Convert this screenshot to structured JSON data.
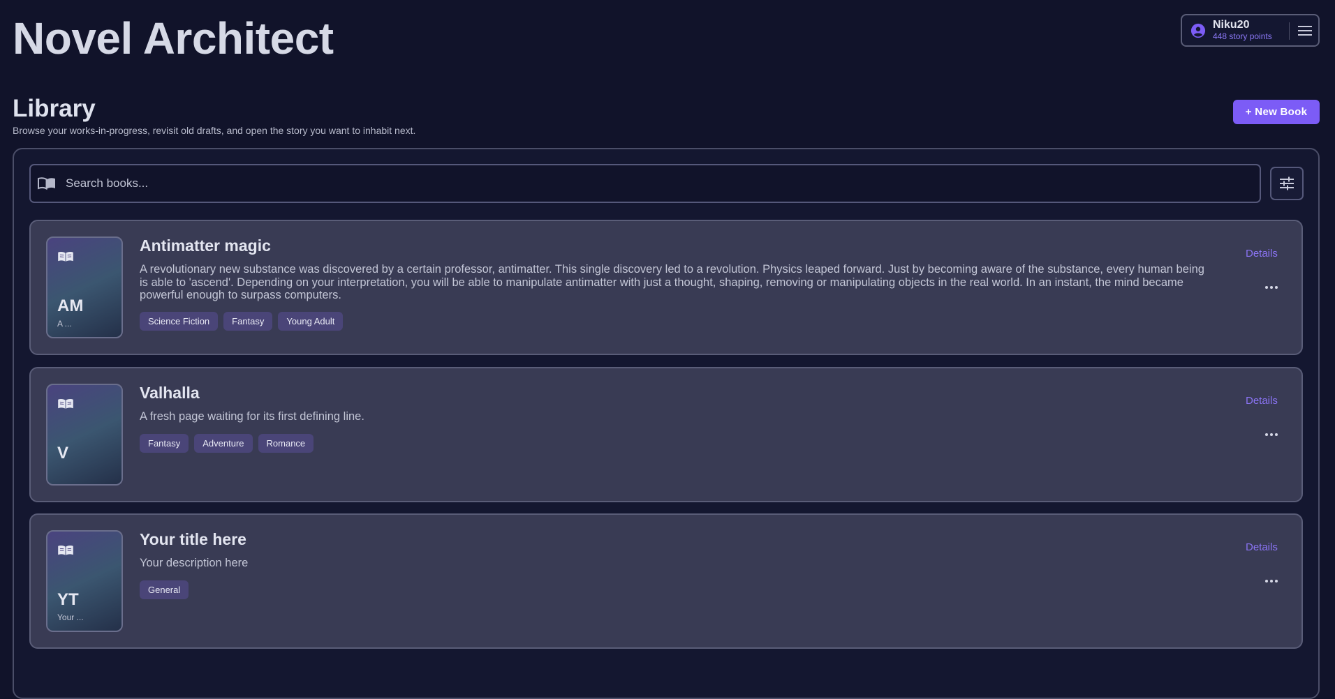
{
  "app": {
    "title": "Novel Architect"
  },
  "user": {
    "name": "Niku20",
    "points": "448 story points"
  },
  "library": {
    "title": "Library",
    "subtitle": "Browse your works-in-progress, revisit old drafts, and open the story you want to inhabit next.",
    "new_book_label": "+ New Book"
  },
  "search": {
    "placeholder": "Search books...",
    "value": ""
  },
  "colors": {
    "accent": "#7c5cf6",
    "background": "#11132a",
    "card": "#393b54",
    "tag": "#4a4578",
    "link": "#8b74f5"
  },
  "books": [
    {
      "initials": "AM",
      "cover_snippet": "A ...",
      "title": "Antimatter magic",
      "description": "A revolutionary new substance was discovered by a certain professor, antimatter. This single discovery led to a revolution. Physics leaped forward. Just by becoming aware of the substance, every human being is able to 'ascend'. Depending on your interpretation, you will be able to manipulate antimatter with just a thought, shaping, removing or manipulating objects in the real world. In an instant, the mind became powerful enough to surpass computers.",
      "tags": [
        "Science Fiction",
        "Fantasy",
        "Young Adult"
      ],
      "details_label": "Details"
    },
    {
      "initials": "V",
      "cover_snippet": "",
      "title": "Valhalla",
      "description": "A fresh page waiting for its first defining line.",
      "tags": [
        "Fantasy",
        "Adventure",
        "Romance"
      ],
      "details_label": "Details"
    },
    {
      "initials": "YT",
      "cover_snippet": "Your ...",
      "title": "Your title here",
      "description": "Your description here",
      "tags": [
        "General"
      ],
      "details_label": "Details"
    }
  ]
}
